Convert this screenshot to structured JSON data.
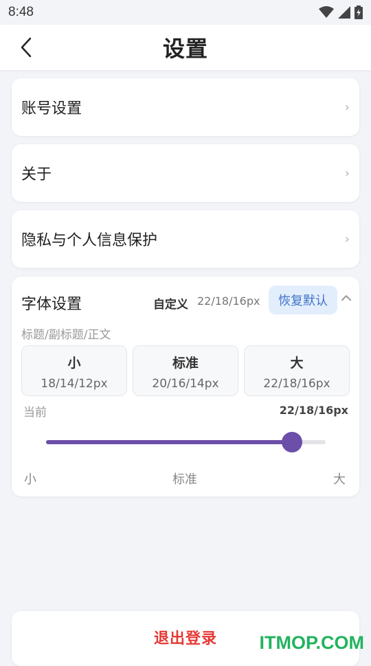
{
  "status_bar": {
    "time": "8:48",
    "icons": [
      "wifi-icon",
      "signal-icon",
      "battery-charging-icon"
    ]
  },
  "header": {
    "title": "设置",
    "back_icon": "back-arrow-icon"
  },
  "menu": [
    {
      "label": "账号设置",
      "chevron": "›"
    },
    {
      "label": "关于",
      "chevron": "›"
    },
    {
      "label": "隐私与个人信息保护",
      "chevron": "›"
    }
  ],
  "font_settings": {
    "title": "字体设置",
    "mode": "自定义",
    "mode_value": "22/18/16px",
    "restore_label": "恢复默认",
    "hint": "标题/副标题/正文",
    "options": [
      {
        "name": "小",
        "px": "18/14/12px"
      },
      {
        "name": "标准",
        "px": "20/16/14px"
      },
      {
        "name": "大",
        "px": "22/18/16px"
      }
    ],
    "current_label": "当前",
    "current_value": "22/18/16px",
    "slider_level": 0.88,
    "ticks": [
      "小",
      "标准",
      "大"
    ]
  },
  "logout_label": "退出登录",
  "watermark": "ITMOP.COM",
  "colors": {
    "accent": "#6b4fa8",
    "danger": "#e53935",
    "restore_bg": "#e3eefc",
    "restore_text": "#3f74c9"
  }
}
